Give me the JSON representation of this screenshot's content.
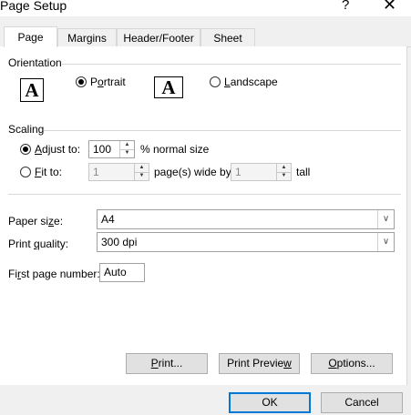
{
  "window": {
    "title": "Page Setup",
    "help": "?",
    "close": "✕"
  },
  "tabs": [
    {
      "label": "Page"
    },
    {
      "label": "Margins"
    },
    {
      "label": "Header/Footer"
    },
    {
      "label": "Sheet"
    }
  ],
  "orientation": {
    "section_label": "Orientation",
    "portrait_pre": "P",
    "portrait_u": "o",
    "portrait_post": "rtrait",
    "landscape_u": "L",
    "landscape_post": "andscape",
    "selected": "portrait",
    "icon_letter": "A"
  },
  "scaling": {
    "section_label": "Scaling",
    "adjust_u": "A",
    "adjust_post": "djust to:",
    "adjust_value": "100",
    "adjust_suffix": "% normal size",
    "fit_u": "F",
    "fit_post": "it to:",
    "fit_wide_value": "1",
    "fit_wide_suffix": "page(s) wide by",
    "fit_tall_value": "1",
    "fit_tall_suffix": "tall",
    "selected": "adjust"
  },
  "paper_size": {
    "label_pre": "Paper si",
    "label_u": "z",
    "label_post": "e:",
    "value": "A4"
  },
  "print_quality": {
    "label_pre": "Print ",
    "label_u": "q",
    "label_post": "uality:",
    "value": "300 dpi"
  },
  "first_page": {
    "label_pre": "Fi",
    "label_u": "r",
    "label_post": "st page number:",
    "value": "Auto"
  },
  "buttons": {
    "print_u": "P",
    "print_post": "rint...",
    "preview_pre": "Print Previe",
    "preview_u": "w",
    "options_u": "O",
    "options_post": "ptions...",
    "ok": "OK",
    "cancel": "Cancel"
  }
}
